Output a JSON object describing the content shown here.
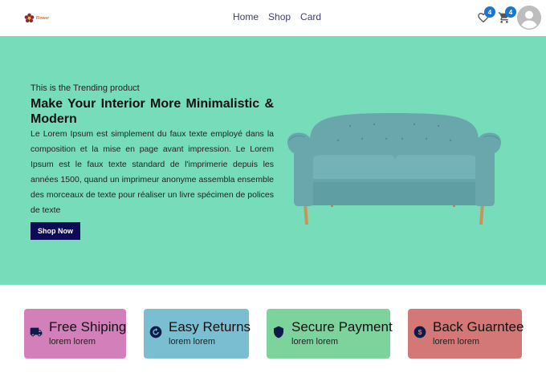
{
  "navbar": {
    "logo_text": "Flower",
    "links": [
      "Home",
      "Shop",
      "Card"
    ],
    "wishlist_count": "4",
    "cart_count": "4",
    "icons": {
      "wishlist": "heart-outline-icon",
      "cart": "shopping-cart-icon",
      "avatar": "user-avatar-icon"
    }
  },
  "hero": {
    "background": "#76dcba",
    "eyebrow": "This is the Trending product",
    "title": "Make Your Interior More Minimalistic & Modern",
    "body": "Le Lorem Ipsum est simplement du faux texte employé dans la composition et la mise en page avant impression. Le Lorem Ipsum est le faux texte standard de l'imprimerie depuis les années 1500, quand un imprimeur anonyme assembla ensemble des morceaux de texte pour réaliser un livre spécimen de polices de texte",
    "button_label": "Shop Now",
    "button_color": "#0b0b56"
  },
  "features": [
    {
      "title": "Free Shiping",
      "subtitle": "lorem lorem",
      "icon": "truck-icon",
      "color": "#d27fba"
    },
    {
      "title": "Easy Returns",
      "subtitle": "lorem lorem",
      "icon": "return-icon",
      "color": "#7abfd1"
    },
    {
      "title": "Secure Payment",
      "subtitle": "lorem lorem",
      "icon": "shield-icon",
      "color": "#7dd39c"
    },
    {
      "title": "Back Guarntee",
      "subtitle": "lorem lorem",
      "icon": "dollar-icon",
      "color": "#d37876"
    }
  ]
}
